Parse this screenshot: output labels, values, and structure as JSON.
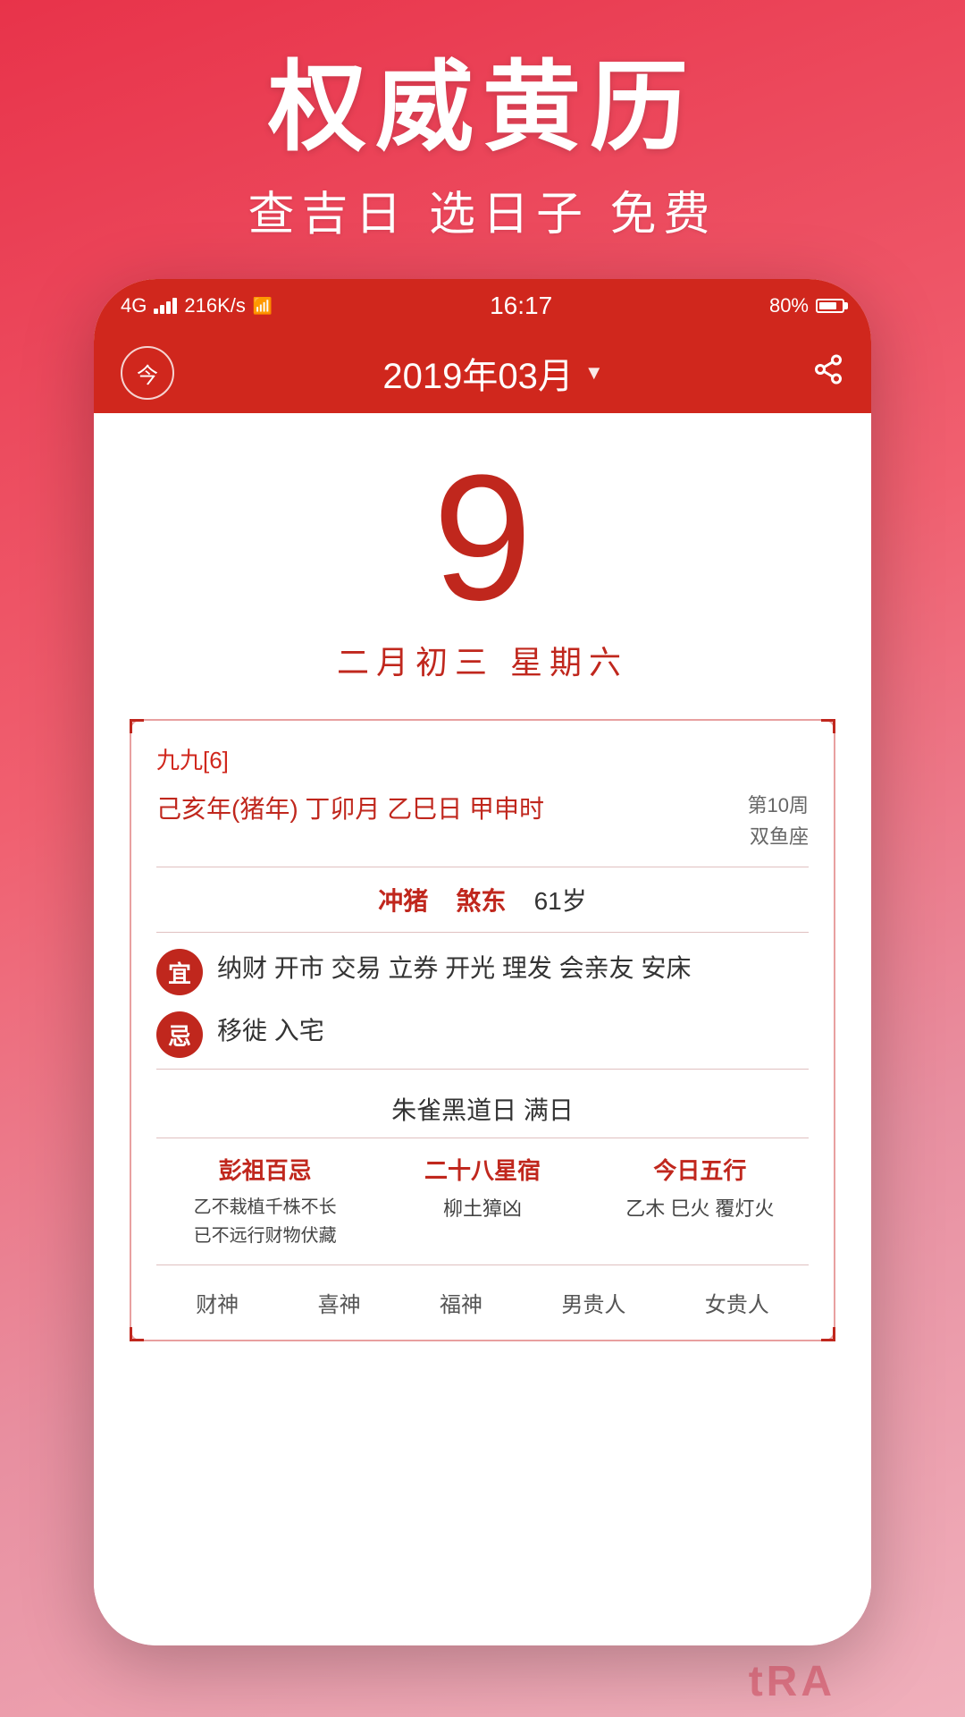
{
  "promo": {
    "title": "权威黄历",
    "subtitle": "查吉日 选日子 免费"
  },
  "statusBar": {
    "signal": "4G",
    "speed": "216K/s",
    "time": "16:17",
    "battery": "80%"
  },
  "header": {
    "todayLabel": "今",
    "monthTitle": "2019年03月",
    "dropdownIcon": "▼"
  },
  "dateDisplay": {
    "day": "9",
    "lunar": "二月初三  星期六"
  },
  "calendarInfo": {
    "jiujiu": "九九[6]",
    "ganzhi": "己亥年(猪年) 丁卯月 乙巳日 甲申时",
    "week": "第10周",
    "zodiac": "双鱼座",
    "chong": "冲猪",
    "sha": "煞东",
    "age": "61岁",
    "yi": {
      "label": "宜",
      "content": "纳财 开市 交易 立券 开光 理发 会亲友 安床"
    },
    "ji": {
      "label": "忌",
      "content": "移徙 入宅"
    },
    "zhuri": "朱雀黑道日  满日",
    "pengzu": {
      "title": "彭祖百忌",
      "content": "乙不栽植千株不长\n已不远行财物伏藏"
    },
    "xingxiu": {
      "title": "二十八星宿",
      "content": "柳土獐凶"
    },
    "wuxing": {
      "title": "今日五行",
      "content": "乙木 巳火 覆灯火"
    },
    "shen": {
      "caíshen": "财神",
      "xíshen": "喜神",
      "fúshen": "福神",
      "nánguì": "男贵人",
      "nǚguì": "女贵人"
    }
  },
  "watermark": {
    "text": "tRA"
  }
}
